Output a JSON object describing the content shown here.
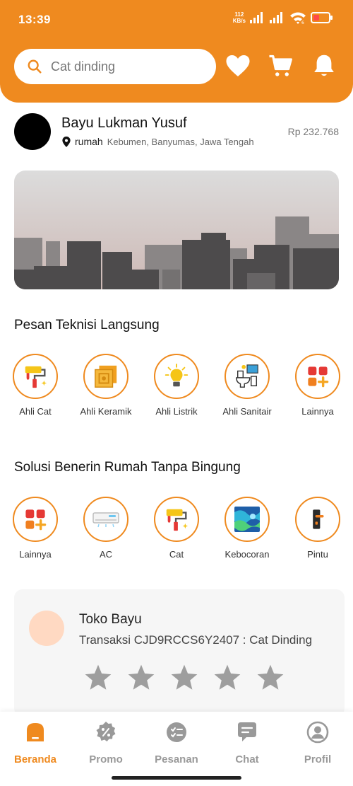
{
  "status_bar": {
    "time": "13:39",
    "net_speed_value": "112",
    "net_speed_unit": "KB/s",
    "wifi_badge": "6"
  },
  "search": {
    "placeholder": "Cat dinding"
  },
  "user": {
    "name": "Bayu Lukman Yusuf",
    "location_label": "rumah",
    "address": "Kebumen, Banyumas, Jawa Tengah",
    "balance": "Rp 232.768"
  },
  "section_teknisi": {
    "title": "Pesan Teknisi Langsung",
    "items": [
      {
        "label": "Ahli Cat",
        "icon": "paint-roller-icon"
      },
      {
        "label": "Ahli Keramik",
        "icon": "tiles-icon"
      },
      {
        "label": "Ahli Listrik",
        "icon": "light-bulb-icon"
      },
      {
        "label": "Ahli Sanitair",
        "icon": "toilet-icon"
      },
      {
        "label": "Lainnya",
        "icon": "grid-plus-icon"
      }
    ]
  },
  "section_solusi": {
    "title": "Solusi Benerin Rumah Tanpa Bingung",
    "items": [
      {
        "label": "Lainnya",
        "icon": "grid-plus-icon"
      },
      {
        "label": "AC",
        "icon": "air-conditioner-icon"
      },
      {
        "label": "Cat",
        "icon": "paint-roller-icon"
      },
      {
        "label": "Kebocoran",
        "icon": "water-leak-icon"
      },
      {
        "label": "Pintu",
        "icon": "door-handle-icon"
      }
    ]
  },
  "review_card": {
    "store": "Toko Bayu",
    "transaction": "Transaksi CJD9RCCS6Y2407 : Cat Dinding",
    "stars_total": 5,
    "stars_filled": 0
  },
  "bottom_nav": {
    "items": [
      {
        "label": "Beranda",
        "icon": "home-icon",
        "active": true
      },
      {
        "label": "Promo",
        "icon": "promo-badge-icon",
        "active": false
      },
      {
        "label": "Pesanan",
        "icon": "orders-icon",
        "active": false
      },
      {
        "label": "Chat",
        "icon": "chat-icon",
        "active": false
      },
      {
        "label": "Profil",
        "icon": "profile-icon",
        "active": false
      }
    ]
  },
  "colors": {
    "brand": "#ef8a1f",
    "inactive": "#999999",
    "star": "#9e9e9e"
  }
}
